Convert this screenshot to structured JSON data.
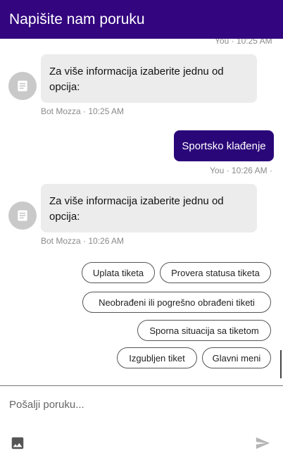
{
  "header": {
    "title": "Napišite nam poruku"
  },
  "messages": {
    "top_meta": "You · 10:25 AM",
    "bot1": {
      "text": "Za više informacija izaberite jednu od opcija:",
      "meta": "Bot Mozza · 10:25 AM"
    },
    "user1": {
      "text": "Sportsko klađenje",
      "meta": "You · 10:26 AM ·"
    },
    "bot2": {
      "text": "Za više informacija izaberite jednu od opcija:",
      "meta": "Bot Mozza · 10:26 AM"
    }
  },
  "quick_replies": [
    "Uplata tiketa",
    "Provera statusa tiketa",
    "Neobrađeni ili pogrešno obrađeni tiketi",
    "Sporna situacija sa tiketom",
    "Izgubljen tiket",
    "Glavni meni"
  ],
  "composer": {
    "placeholder": "Pošalji poruku..."
  },
  "icons": {
    "avatar": "document-icon",
    "attach": "image-icon",
    "send": "send-icon"
  },
  "colors": {
    "header": "#33057f",
    "user_bubble": "#2a0779",
    "bot_bubble": "#ececec"
  }
}
